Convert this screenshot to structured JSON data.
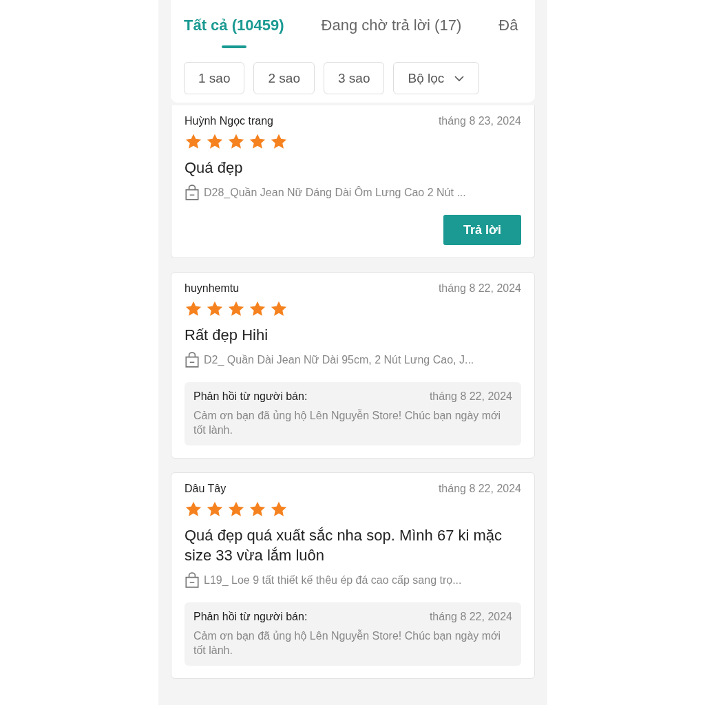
{
  "tabs": [
    {
      "label": "Tất cả (10459)",
      "selected": true
    },
    {
      "label": "Đang chờ trả lời (17)",
      "selected": false
    },
    {
      "label": "Đâ",
      "selected": false
    }
  ],
  "filters": [
    {
      "label": "1 sao",
      "kind": "plain"
    },
    {
      "label": "2 sao",
      "kind": "plain"
    },
    {
      "label": "3 sao",
      "kind": "plain"
    },
    {
      "label": "Bộ lọc",
      "kind": "dropdown"
    }
  ],
  "reviews": [
    {
      "user": "Huỳnh Ngọc trang",
      "date": "tháng 8 23, 2024",
      "stars": 5,
      "comment": "Quá đẹp",
      "product": "D28_Quần Jean Nữ Dáng Dài Ôm Lưng Cao 2 Nút ...",
      "action_button": "Trả lời"
    },
    {
      "user": "huynhemtu",
      "date": "tháng 8 22, 2024",
      "stars": 5,
      "comment": "Rất đẹp Hihi",
      "product": "D2_ Quần Dài Jean Nữ Dài 95cm, 2 Nút Lưng Cao, J...",
      "seller_reply": {
        "label": "Phản hồi từ người bán:",
        "date": "tháng 8 22, 2024",
        "text": "Cảm ơn bạn đã ủng hộ Lên Nguyễn Store! Chúc bạn ngày mới tốt lành."
      }
    },
    {
      "user": "Dâu Tây",
      "date": "tháng 8 22, 2024",
      "stars": 5,
      "comment": "Quá đẹp quá xuất sắc nha sop. Mình 67 ki mặc size 33 vừa lắm luôn",
      "product": "L19_ Loe 9 tất thiết kế thêu ép đá cao cấp sang trọ...",
      "seller_reply": {
        "label": "Phản hồi từ người bán:",
        "date": "tháng 8 22, 2024",
        "text": "Cảm ơn bạn đã ủng hộ Lên Nguyễn Store! Chúc bạn ngày mới tốt lành."
      }
    }
  ]
}
